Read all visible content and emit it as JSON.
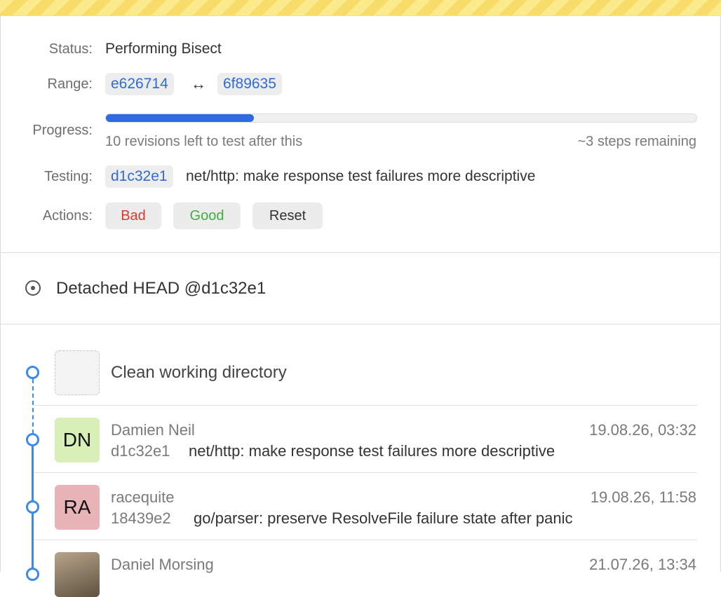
{
  "bisect": {
    "status_label": "Status:",
    "status_value": "Performing Bisect",
    "range_label": "Range:",
    "range_start": "e626714",
    "range_arrow": "↔",
    "range_end": "6f89635",
    "progress_label": "Progress:",
    "progress_fraction": 0.25,
    "progress_left_text": "10 revisions left to test after this",
    "progress_right_text": "~3 steps remaining",
    "testing_label": "Testing:",
    "testing_hash": "d1c32e1",
    "testing_message": "net/http: make response test failures more descriptive",
    "actions_label": "Actions:",
    "actions": [
      {
        "label": "Bad",
        "color": "#d93a2b"
      },
      {
        "label": "Good",
        "color": "#3fae3f"
      },
      {
        "label": "Reset",
        "color": "#333333"
      }
    ]
  },
  "head": {
    "icon": "target-icon",
    "title": "Detached HEAD @d1c32e1"
  },
  "history": {
    "working_copy": "Clean working directory",
    "commits": [
      {
        "initials": "DN",
        "avatar_color": "#d8f0b8",
        "author": "Damien Neil",
        "date": "19.08.26, 03:32",
        "hash": "d1c32e1",
        "message": "net/http: make response test failures more descriptive"
      },
      {
        "initials": "RA",
        "avatar_color": "#e8b4b8",
        "author": "racequite",
        "date": "19.08.26, 11:58",
        "hash": "18439e2",
        "message": "go/parser: preserve ResolveFile failure state after panic"
      },
      {
        "initials": "",
        "avatar_color": "#8a7a60",
        "author": "Daniel Morsing",
        "date": "21.07.26, 13:34",
        "hash": "",
        "message": ""
      }
    ]
  },
  "colors": {
    "accent": "#3b8be8",
    "progress_fill": "#2e6be0",
    "link": "#2e6bd6"
  }
}
